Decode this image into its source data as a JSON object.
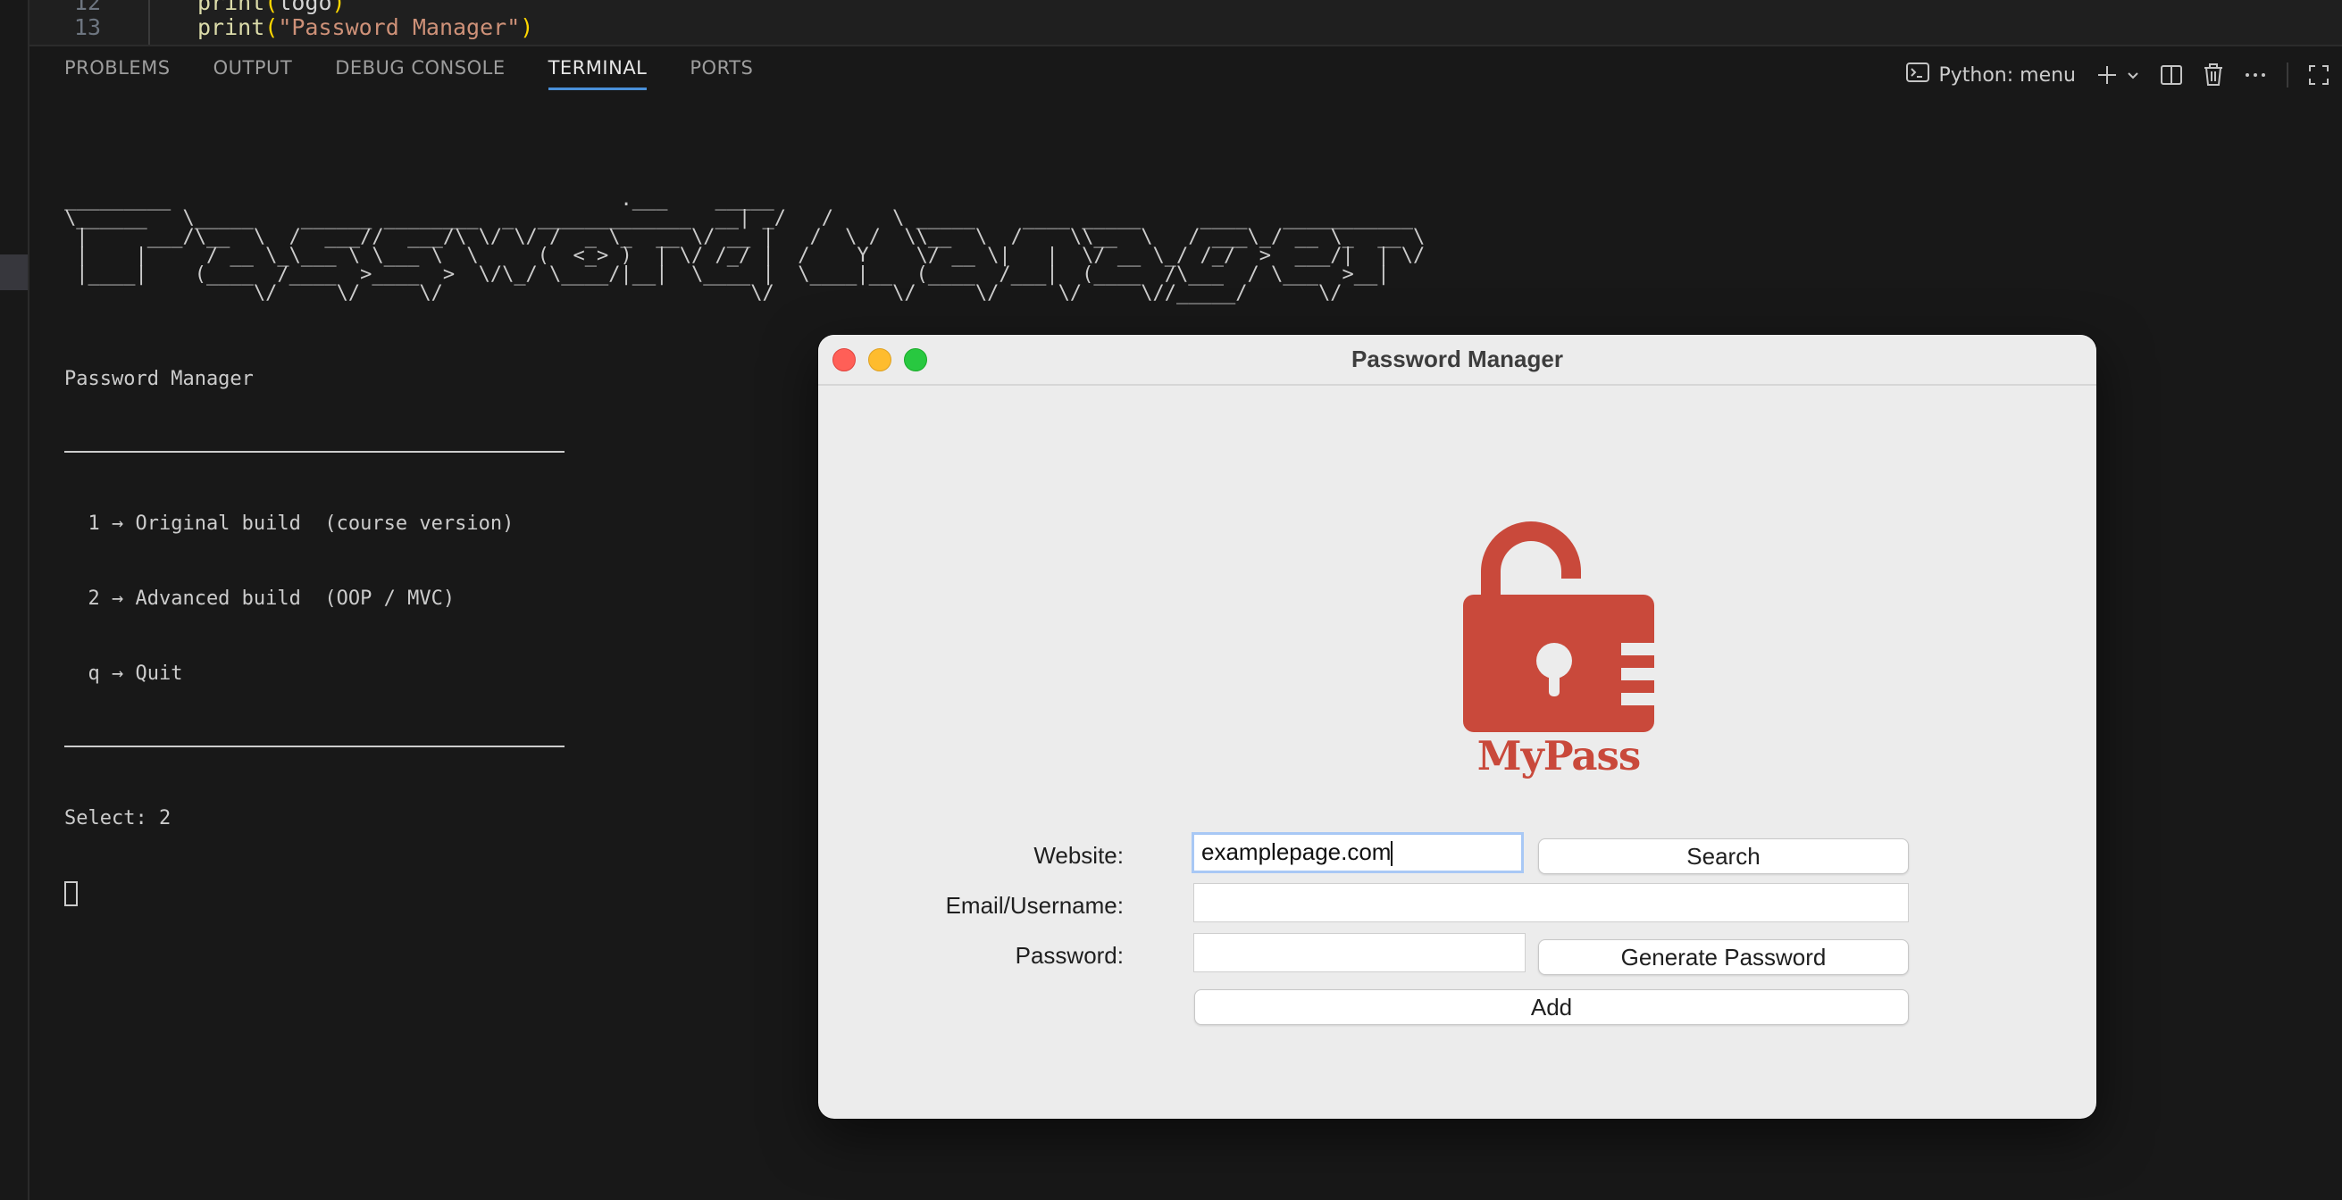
{
  "editor": {
    "lines": [
      {
        "num": "12",
        "fn": "print",
        "arg": "logo",
        "is_string": false
      },
      {
        "num": "13",
        "fn": "print",
        "arg": "\"Password Manager\"",
        "is_string": true
      }
    ]
  },
  "panel": {
    "tabs": [
      {
        "label": "PROBLEMS",
        "active": false
      },
      {
        "label": "OUTPUT",
        "active": false
      },
      {
        "label": "DEBUG CONSOLE",
        "active": false
      },
      {
        "label": "TERMINAL",
        "active": true
      },
      {
        "label": "PORTS",
        "active": false
      }
    ],
    "terminal_name": "Python: menu"
  },
  "terminal": {
    "ascii_banner": "_________                                      .___    _____\n\\______   \\_____    ______ ________  _  _____________  __| _/   /     \\ _____    ____ _____     ____   ___________\n |     ___/\\__  \\  /  ___//  ___/\\ \\/ \\/ /  _ \\_  __ \\/ __ |   /  \\ /  \\\\__  \\  /    \\\\__  \\   / ___\\_/ __ \\_  __ \\\n |    |     / __ \\_\\___ \\ \\___ \\  \\     (  <_> )  | \\/ /_/ |  /    Y    \\/ __ \\|   |  \\/ __ \\_/ /_/  >  ___/|  | \\/\n |____|    (____  /____  >____  >  \\/\\_/ \\____/|__|  \\____ |  \\____|__  (____  /___|  (____  /\\___  / \\___  >__|\n                \\/     \\/     \\/                          \\/          \\/     \\/     \\/     \\//_____/      \\/",
    "heading": "Password Manager",
    "options": [
      "  1 → Original build  (course version)",
      "  2 → Advanced build  (OOP / MVC)",
      "  q → Quit"
    ],
    "prompt": "Select: 2"
  },
  "app_window": {
    "title": "Password Manager",
    "logo_text": "MyPass",
    "logo_color": "#c9493b",
    "website_label": "Website:",
    "website_value": "examplepage.com",
    "email_label": "Email/Username:",
    "email_value": "",
    "password_label": "Password:",
    "password_value": "",
    "search_button": "Search",
    "generate_button": "Generate Password",
    "add_button": "Add"
  },
  "colors": {
    "accent_tab": "#4a90d9",
    "close": "#ff5f57",
    "minimize": "#febc2e",
    "zoom": "#28c840"
  }
}
